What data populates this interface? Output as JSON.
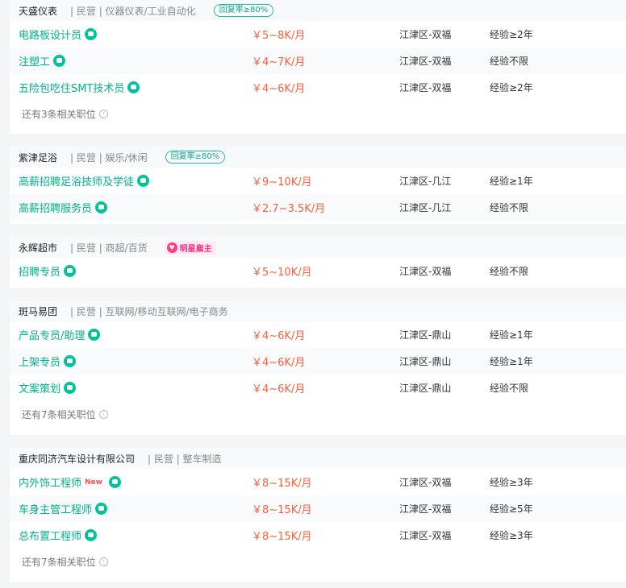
{
  "companies": [
    {
      "name": "天盛仪表",
      "meta": "| 民营 | 仪器仪表/工业自动化",
      "badge": "回复率≥80%",
      "jobs": [
        {
          "title": "电路板设计员",
          "salary": "￥5~8K/月",
          "location": "江津区-双福",
          "experience": "经验≥2年"
        },
        {
          "title": "注塑工",
          "salary": "￥4~7K/月",
          "location": "江津区-双福",
          "experience": "经验不限"
        },
        {
          "title": "五险包吃住SMT技术员",
          "salary": "￥4~6K/月",
          "location": "江津区-双福",
          "experience": "经验≥2年"
        }
      ],
      "more": "还有3条相关职位"
    },
    {
      "name": "紫津足浴",
      "meta": "| 民营 | 娱乐/休闲",
      "badge": "回复率≥80%",
      "jobs": [
        {
          "title": "高薪招聘足浴技师及学徒",
          "salary": "￥9~10K/月",
          "location": "江津区-几江",
          "experience": "经验≥1年"
        },
        {
          "title": "高薪招聘服务员",
          "salary": "￥2.7~3.5K/月",
          "location": "江津区-几江",
          "experience": "经验不限"
        }
      ]
    },
    {
      "name": "永辉超市",
      "meta": "| 民营 | 商超/百货",
      "star_badge": "明星雇主",
      "jobs": [
        {
          "title": "招聘专员",
          "salary": "￥5~10K/月",
          "location": "江津区-双福",
          "experience": "经验不限"
        }
      ]
    },
    {
      "name": "斑马易团",
      "meta": "| 民营 | 互联网/移动互联网/电子商务",
      "jobs": [
        {
          "title": "产品专员/助理",
          "salary": "￥4~6K/月",
          "location": "江津区-鼎山",
          "experience": "经验≥1年"
        },
        {
          "title": "上架专员",
          "salary": "￥4~6K/月",
          "location": "江津区-鼎山",
          "experience": "经验≥1年"
        },
        {
          "title": "文案策划",
          "salary": "￥4~6K/月",
          "location": "江津区-鼎山",
          "experience": "经验不限"
        }
      ],
      "more": "还有7条相关职位"
    },
    {
      "name": "重庆同济汽车设计有限公司",
      "meta": "| 民营 | 整车制造",
      "jobs": [
        {
          "title": "内外饰工程师",
          "new_tag": "New",
          "salary": "￥8~15K/月",
          "location": "江津区-双福",
          "experience": "经验≥3年"
        },
        {
          "title": "车身主管工程师",
          "salary": "￥8~15K/月",
          "location": "江津区-双福",
          "experience": "经验≥5年"
        },
        {
          "title": "总布置工程师",
          "salary": "￥8~15K/月",
          "location": "江津区-双福",
          "experience": "经验≥3年"
        }
      ],
      "more": "还有7条相关职位"
    }
  ],
  "icons": {
    "chat": "chat-bubble-icon",
    "info": "info-icon",
    "heart": "heart-icon"
  },
  "colors": {
    "job_title": "#00b38a",
    "salary": "#fd5f39",
    "badge": "#17c3a5",
    "star": "#ff2d7f"
  }
}
